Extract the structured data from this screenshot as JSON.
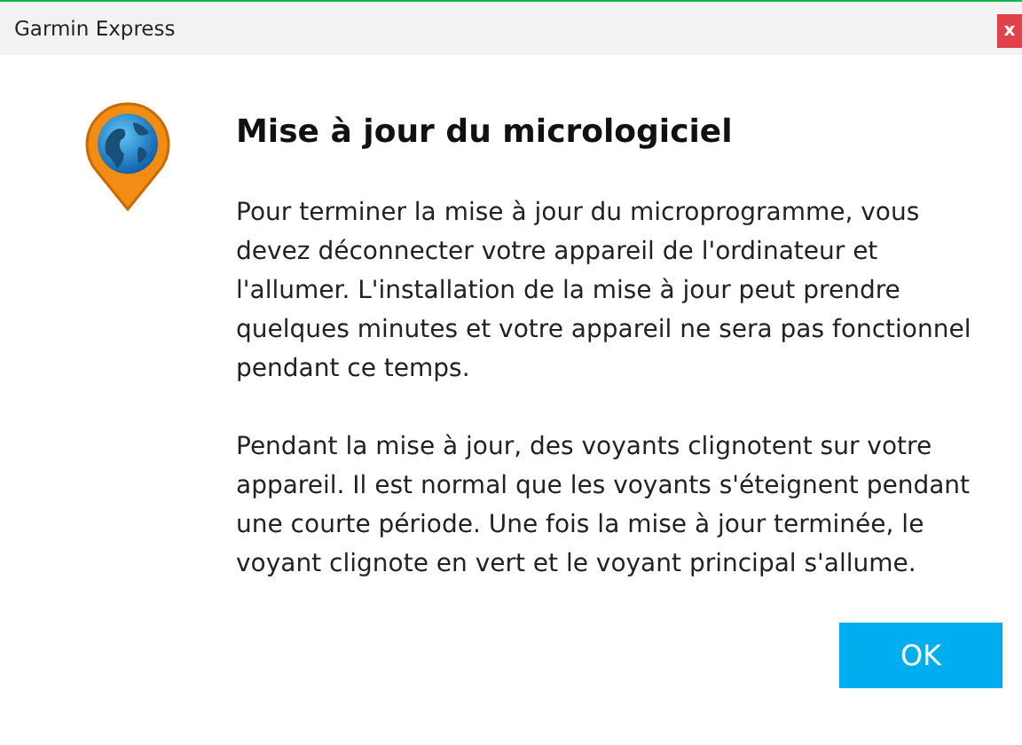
{
  "window": {
    "title": "Garmin Express",
    "close": "x"
  },
  "dialog": {
    "heading": "Mise à jour du micrologiciel",
    "paragraphs": [
      "Pour terminer la mise à jour du microprogramme, vous devez déconnecter votre appareil de l'ordinateur et l'allumer. L'installation de la mise à jour peut prendre quelques minutes et votre appareil ne sera pas fonctionnel pendant ce temps.",
      "Pendant la mise à jour, des voyants clignotent sur votre appareil. Il est normal que les voyants s'éteignent pendant une courte période. Une fois la mise à jour terminée, le voyant clignote en vert et le voyant principal s'allume."
    ],
    "buttons": [
      "OK"
    ]
  }
}
